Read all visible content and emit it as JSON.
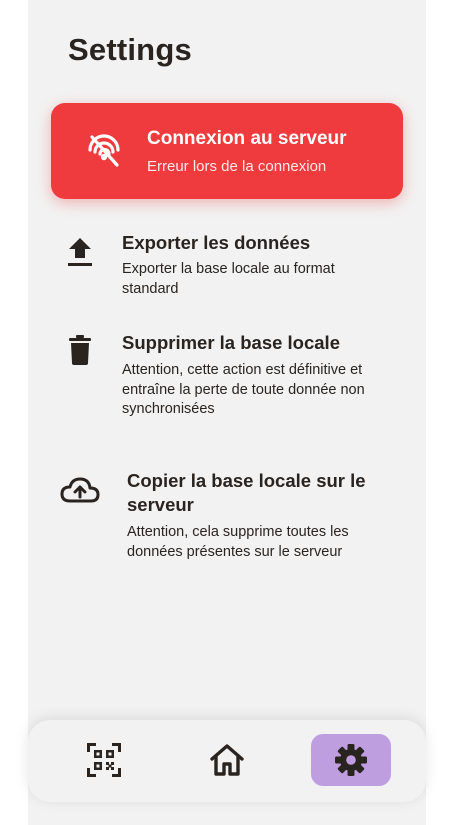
{
  "page": {
    "title": "Settings"
  },
  "connection": {
    "icon": "wifi-off-icon",
    "title": "Connexion au serveur",
    "status": "Erreur lors de la connexion",
    "color": "#ef3b3d"
  },
  "actions": [
    {
      "icon": "upload-icon",
      "title": "Exporter les données",
      "description": "Exporter la base locale au format standard"
    },
    {
      "icon": "trash-icon",
      "title": "Supprimer la base locale",
      "description": "Attention, cette action est définitive et entraîne la perte de toute donnée non synchronisées"
    },
    {
      "icon": "cloud-upload-icon",
      "title": "Copier la base locale sur le serveur",
      "description": "Attention, cela supprime toutes les données présentes sur le serveur"
    }
  ],
  "nav": {
    "items": [
      {
        "icon": "qr-code-icon",
        "active": false
      },
      {
        "icon": "home-icon",
        "active": false
      },
      {
        "icon": "gear-icon",
        "active": true
      }
    ],
    "active_color": "#bf9ee0"
  }
}
